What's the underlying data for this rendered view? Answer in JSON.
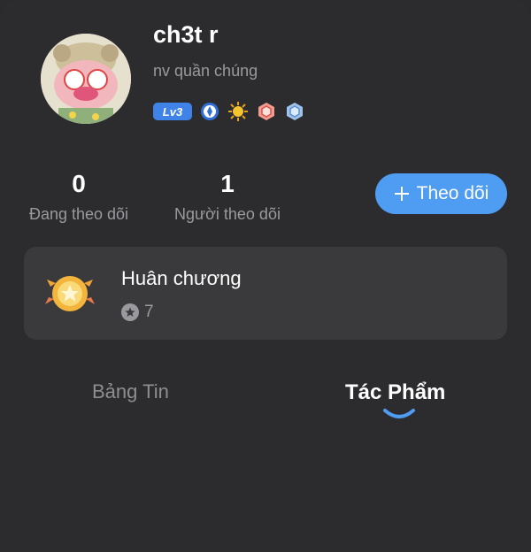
{
  "profile": {
    "username": "ch3t r",
    "subtitle": "nv quần chúng",
    "level": "Lv3",
    "badges": [
      "blue-shield-icon",
      "sun-icon",
      "red-hexagon-icon",
      "blue-crystal-icon"
    ]
  },
  "stats": {
    "following_count": "0",
    "following_label": "Đang theo dõi",
    "followers_count": "1",
    "followers_label": "Người theo dõi"
  },
  "follow_button": {
    "label": "Theo dõi",
    "icon": "plus-icon"
  },
  "medals": {
    "title": "Huân chương",
    "count": "7"
  },
  "tabs": [
    {
      "label": "Bảng Tin",
      "active": false
    },
    {
      "label": "Tác Phẩm",
      "active": true
    }
  ],
  "colors": {
    "accent": "#4f9cf3",
    "background": "#2c2c2e",
    "card": "#3a3a3c",
    "muted": "#9a9a9e"
  }
}
